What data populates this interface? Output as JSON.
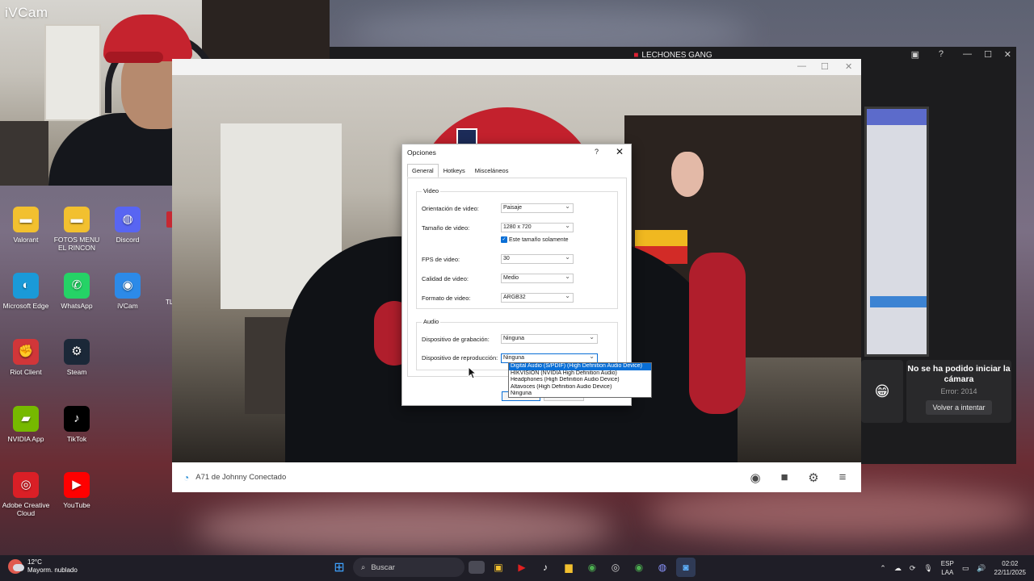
{
  "preview": {
    "brand": "iVCam"
  },
  "desktop_icons": [
    {
      "label": "Valorant",
      "color": "#f2c02f"
    },
    {
      "label": "FOTOS MENU EL RINCON",
      "color": "#f2c02f"
    },
    {
      "label": "Discord",
      "color": "#5865f2"
    },
    {
      "label": "Microsoft Edge",
      "color": "#1a9ad8"
    },
    {
      "label": "WhatsApp",
      "color": "#25d366"
    },
    {
      "label": "iVCam",
      "color": "#2c8ae8"
    },
    {
      "label": "Riot Client",
      "color": "#d13639"
    },
    {
      "label": "Steam",
      "color": "#1b2838"
    },
    {
      "label": "NVIDIA App",
      "color": "#76b900"
    },
    {
      "label": "TikTok",
      "color": "#000000"
    },
    {
      "label": "Adobe Creative Cloud",
      "color": "#da1f26"
    },
    {
      "label": "YouTube",
      "color": "#ff0000"
    }
  ],
  "partial_icon_label": "TL",
  "dark_window": {
    "title": "LECHONES GANG",
    "error_title": "No se ha podido iniciar la cámara",
    "error_code": "Error: 2014",
    "retry_label": "Volver a intentar"
  },
  "ivcam": {
    "status": "A71 de Johnny Conectado",
    "tools": [
      "camera-icon",
      "video-icon",
      "settings-icon",
      "menu-icon"
    ]
  },
  "dialog": {
    "title": "Opciones",
    "help": "?",
    "tabs": [
      "General",
      "Hotkeys",
      "Misceláneos"
    ],
    "video_group": "Video",
    "orientation_label": "Orientación de video:",
    "orientation_value": "Paisaje",
    "size_label": "Tamaño de video:",
    "size_value": "1280 x 720",
    "size_only_label": "Este tamaño solamente",
    "fps_label": "FPS de video:",
    "fps_value": "30",
    "quality_label": "Calidad de video:",
    "quality_value": "Medio",
    "format_label": "Formato de video:",
    "format_value": "ARGB32",
    "audio_group": "Audio",
    "record_label": "Dispositivo de grabación:",
    "record_value": "Ninguna",
    "playback_label": "Dispositivo de reproducción:",
    "playback_value": "Ninguna",
    "playback_options": [
      "Digital Audio (S/PDIF) (High Definition Audio Device)",
      "HIKVISION (NVIDIA High Definition Audio)",
      "Headphones (High Definition Audio Device)",
      "Altavoces (High Definition Audio Device)",
      "Ninguna"
    ]
  },
  "taskbar": {
    "weather_temp": "12°C",
    "weather_desc": "Mayorm. nublado",
    "search_placeholder": "Buscar",
    "lang1": "ESP",
    "lang2": "LAA",
    "time": "02:02",
    "date": "22/11/2025"
  },
  "colors": {
    "accent": "#0a6fd6",
    "taskbar": "#1f1e27"
  }
}
